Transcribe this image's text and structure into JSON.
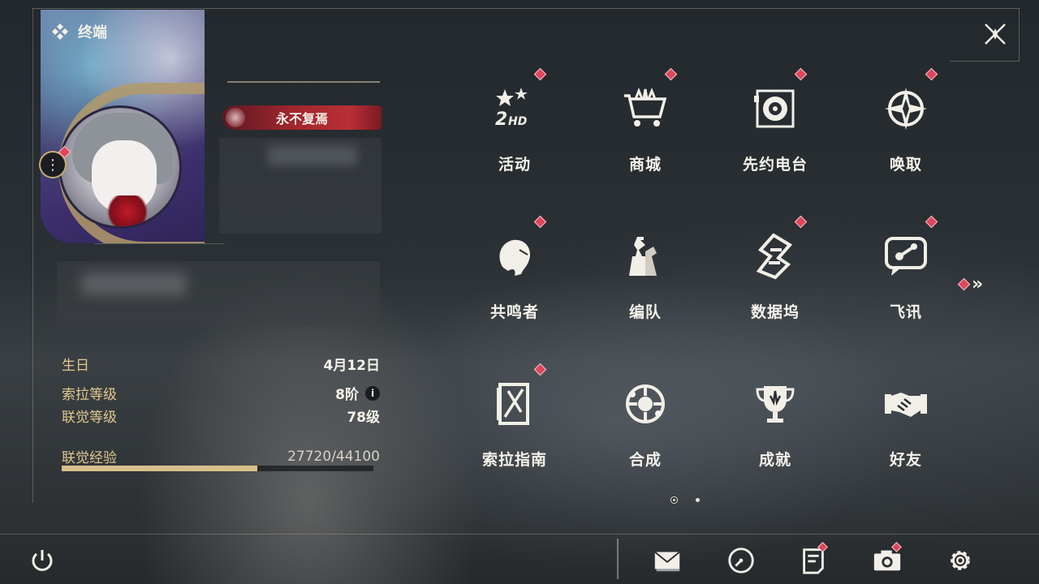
{
  "header": {
    "title": "终端",
    "close_icon": "close-x-icon"
  },
  "profile": {
    "title_badge": "永不复焉",
    "stats": [
      {
        "label": "生日",
        "value": "4月12日"
      },
      {
        "label": "索拉等级",
        "value": "8阶"
      },
      {
        "label": "联觉等级",
        "value": "78级"
      }
    ],
    "exp": {
      "label": "联觉经验",
      "value": "27720/44100",
      "current": 27720,
      "max": 44100
    },
    "info_icon": "i"
  },
  "grid": {
    "items": [
      {
        "label": "活动",
        "icon": "event-2hd-icon",
        "badge": true
      },
      {
        "label": "商城",
        "icon": "shop-cart-icon",
        "badge": true
      },
      {
        "label": "先约电台",
        "icon": "radio-icon",
        "badge": true
      },
      {
        "label": "唤取",
        "icon": "summon-compass-icon",
        "badge": true
      },
      {
        "label": "共鸣者",
        "icon": "resonator-icon",
        "badge": true
      },
      {
        "label": "编队",
        "icon": "team-chess-icon",
        "badge": false
      },
      {
        "label": "数据坞",
        "icon": "data-dock-icon",
        "badge": true
      },
      {
        "label": "飞讯",
        "icon": "message-icon",
        "badge": true
      },
      {
        "label": "索拉指南",
        "icon": "guide-book-icon",
        "badge": true
      },
      {
        "label": "合成",
        "icon": "synthesis-icon",
        "badge": false
      },
      {
        "label": "成就",
        "icon": "trophy-icon",
        "badge": false
      },
      {
        "label": "好友",
        "icon": "handshake-icon",
        "badge": false
      }
    ],
    "pages": 2,
    "current_page": 1
  },
  "bottom": {
    "buttons": [
      "mail-icon",
      "clock-icon",
      "notice-icon",
      "camera-icon",
      "settings-gear-icon"
    ],
    "power_icon": "power-icon"
  },
  "colors": {
    "accent_gold": "#d8c08a",
    "badge_red": "#e0455a",
    "title_red": "#ba2f36"
  }
}
